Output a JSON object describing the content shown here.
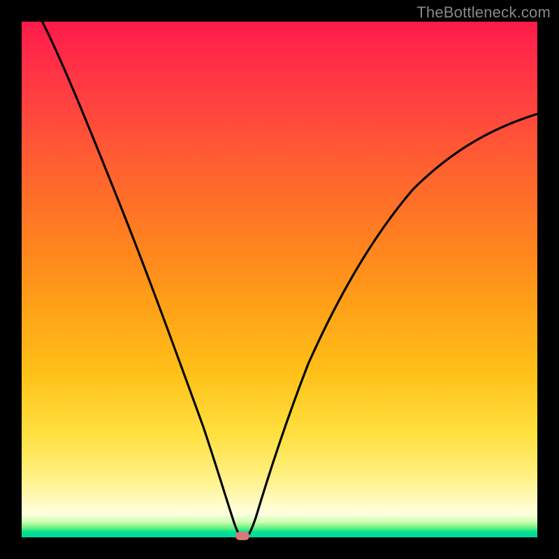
{
  "watermark": "TheBottleneck.com",
  "chart_data": {
    "type": "line",
    "title": "",
    "xlabel": "",
    "ylabel": "",
    "xlim": [
      0,
      100
    ],
    "ylim": [
      0,
      100
    ],
    "x": [
      4,
      7,
      10,
      13,
      16,
      19,
      22,
      25,
      28,
      31,
      34,
      37,
      39,
      40.5,
      42,
      43,
      44,
      46,
      48,
      51,
      55,
      60,
      66,
      73,
      81,
      90,
      100
    ],
    "values": [
      100,
      93,
      86,
      79,
      72,
      64,
      56,
      48,
      40,
      31,
      22,
      13,
      6,
      2,
      0.5,
      0.5,
      2,
      8,
      16,
      26,
      37,
      47,
      56,
      64,
      71,
      77,
      82
    ],
    "marker": {
      "x": 42.5,
      "y": 0
    },
    "background_gradient": {
      "top": "#ff1a4a",
      "middle": "#ffe040",
      "bottom": "#00d8a0"
    }
  }
}
